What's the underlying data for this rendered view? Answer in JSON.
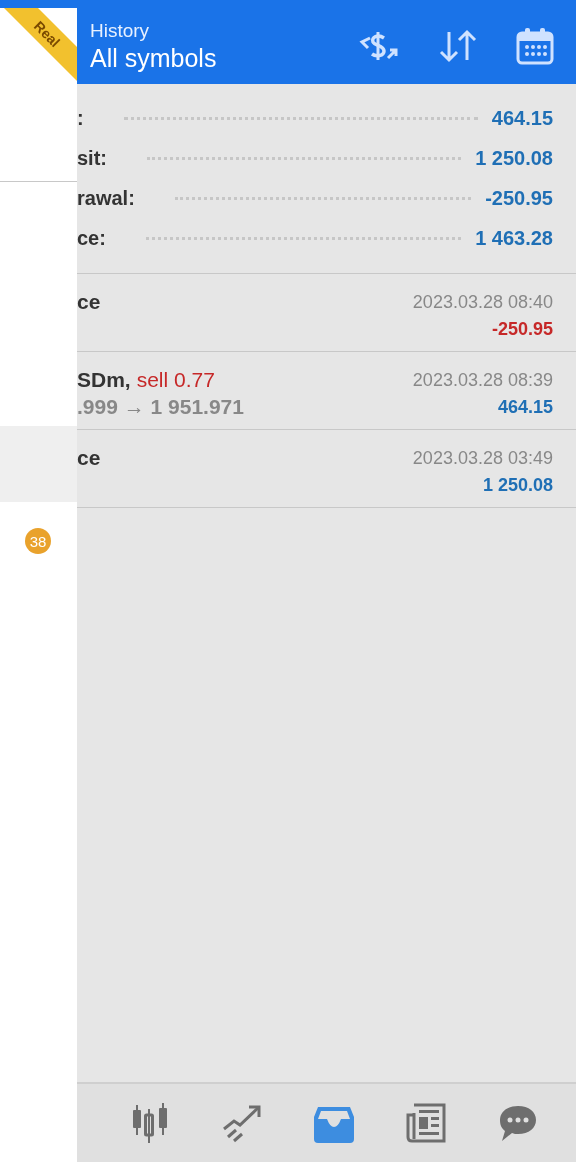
{
  "drawer": {
    "ribbon": "Real",
    "items": [
      {
        "selected": true
      }
    ],
    "badge": "38"
  },
  "header": {
    "title": "History",
    "subtitle": "All symbols"
  },
  "summary": [
    {
      "label": ":",
      "value": "464.15"
    },
    {
      "label": "sit:",
      "value": "1 250.08"
    },
    {
      "label": "rawal:",
      "value": "-250.95"
    },
    {
      "label": "ce:",
      "value": "1 463.28"
    }
  ],
  "deals": [
    {
      "kind": "balance",
      "title": "ce",
      "time": "2023.03.28 08:40",
      "amount": "-250.95",
      "color": "#c62828"
    },
    {
      "kind": "trade",
      "title": "SDm,",
      "deal": "sell 0.77",
      "prices": ".999 → 1 951.971",
      "time": "2023.03.28 08:39",
      "amount": "464.15",
      "color": "#1f6fb5"
    },
    {
      "kind": "balance",
      "title": "ce",
      "time": "2023.03.28 03:49",
      "amount": "1 250.08",
      "color": "#1f6fb5"
    }
  ],
  "nav": [
    {
      "selected": false
    },
    {
      "selected": false
    },
    {
      "selected": true
    },
    {
      "selected": false
    },
    {
      "selected": false
    }
  ]
}
